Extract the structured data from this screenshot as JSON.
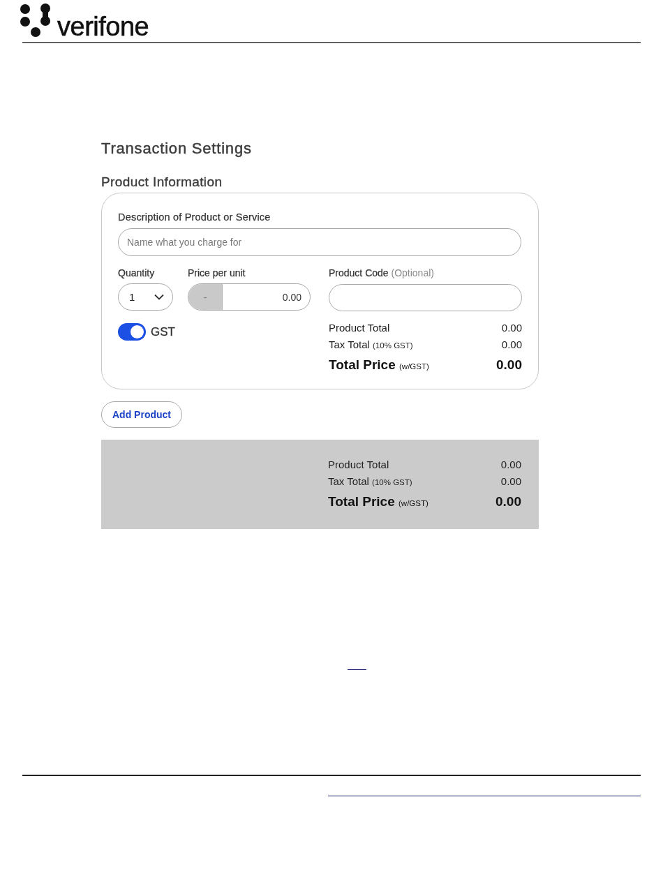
{
  "header": {
    "logo_text": "verifone"
  },
  "page_title": "Transaction Settings",
  "section_title": "Product Information",
  "product_card": {
    "description": {
      "label": "Description of Product or Service",
      "placeholder": "Name what you charge for"
    },
    "quantity": {
      "label": "Quantity",
      "value": "1"
    },
    "price": {
      "label": "Price per unit",
      "prefix": "-",
      "value": "0.00"
    },
    "product_code": {
      "label": "Product Code",
      "hint": "(Optional)"
    },
    "gst_toggle": {
      "label": "GST",
      "on": true
    },
    "totals": [
      {
        "kind": "line",
        "label": "Product Total",
        "value": "0.00"
      },
      {
        "kind": "line",
        "label": "Tax Total",
        "note": "(10% GST)",
        "value": "0.00"
      },
      {
        "kind": "grand",
        "label": "Total Price",
        "note": "(w/GST)",
        "value": "0.00"
      }
    ]
  },
  "add_button": "Add Product",
  "summary": {
    "totals": [
      {
        "kind": "line",
        "label": "Product Total",
        "value": "0.00"
      },
      {
        "kind": "line",
        "label": "Tax Total",
        "note": "(10% GST)",
        "value": "0.00"
      },
      {
        "kind": "grand",
        "label": "Total Price",
        "note": "(w/GST)",
        "value": "0.00"
      }
    ]
  }
}
